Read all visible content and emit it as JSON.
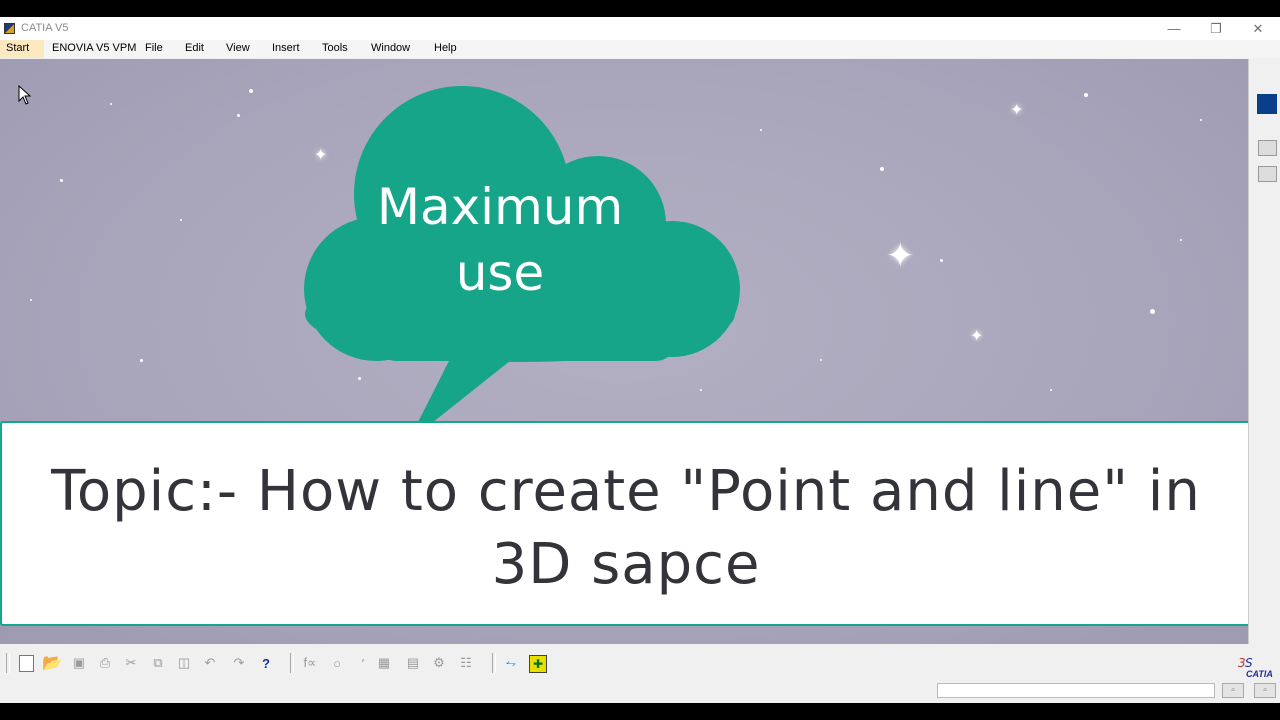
{
  "window": {
    "title": "CATIA V5"
  },
  "menu": {
    "items": [
      "Start",
      "ENOVIA V5 VPM",
      "File",
      "Edit",
      "View",
      "Insert",
      "Tools",
      "Window",
      "Help"
    ]
  },
  "bubble": {
    "text_line1": "Maximum",
    "text_line2": "use",
    "color": "#16a589"
  },
  "topic": {
    "line1": "Topic:- How to create \"Point and line\" in",
    "line2": "3D sapce",
    "border_color": "#14a78a"
  },
  "toolbar": {
    "icons": [
      "new-icon",
      "open-icon",
      "save-icon",
      "print-icon",
      "cut-icon",
      "copy-icon",
      "paste-icon",
      "undo-icon",
      "redo-icon",
      "whats-this-icon",
      "formula-icon",
      "knowledge-icon",
      "measure-icon",
      "table-icon",
      "catalog-icon",
      "swap-icon",
      "filter-icon",
      "axis-icon",
      "select-icon"
    ]
  },
  "brand": {
    "logo_text": "CATIA"
  },
  "status": {
    "power_input_value": "",
    "accent": "#0a3d8a"
  }
}
